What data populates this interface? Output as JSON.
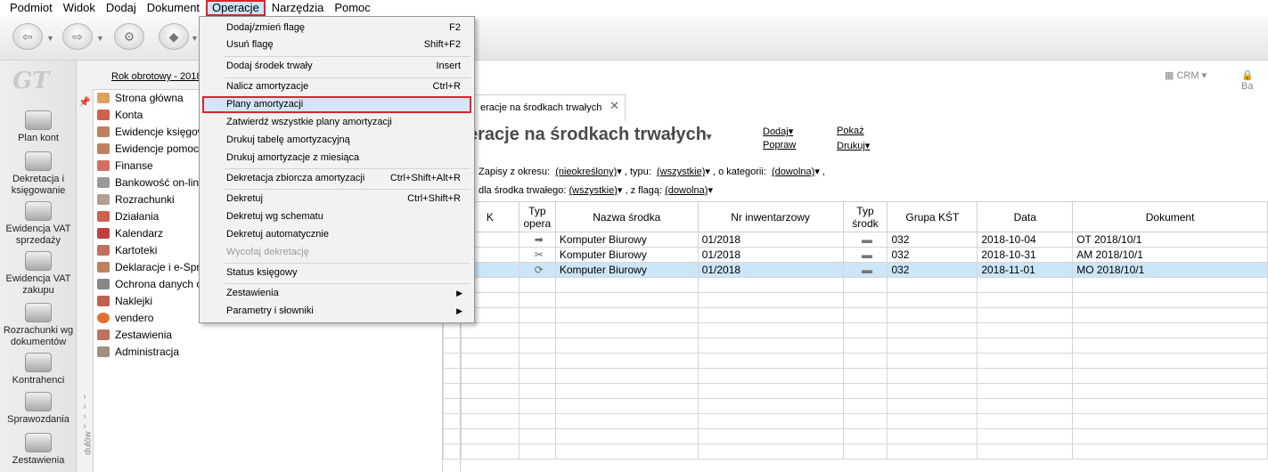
{
  "menubar": [
    "Podmiot",
    "Widok",
    "Dodaj",
    "Dokument",
    "Operacje",
    "Narzędzia",
    "Pomoc"
  ],
  "active_menu": "Operacje",
  "modules": [
    {
      "label": "Plan kont"
    },
    {
      "label": "Dekretacja i księgowanie"
    },
    {
      "label": "Ewidencja VAT sprzedaży"
    },
    {
      "label": "Ewidencja VAT zakupu"
    },
    {
      "label": "Rozrachunki wg dokumentów"
    },
    {
      "label": "Kontrahenci"
    },
    {
      "label": "Sprawozdania"
    },
    {
      "label": "Zestawienia"
    }
  ],
  "logo_text": "GT",
  "fiscal_year": "Rok obrotowy - 2018",
  "tree": [
    "Strona główna",
    "Konta",
    "Ewidencje księgow",
    "Ewidencje pomocr",
    "Finanse",
    "Bankowość on-line",
    "Rozrachunki",
    "Działania",
    "Kalendarz",
    "Kartoteki",
    "Deklaracje i e-Spra",
    "Ochrona danych o",
    "Naklejki",
    "vendero",
    "Zestawienia",
    "Administracja"
  ],
  "side_grip_text": "dułów",
  "header_right": {
    "crm": "CRM",
    "ba": "Ba"
  },
  "tab": {
    "label": "eracje na środkach trwałych"
  },
  "page": {
    "title": "eracje na środkach trwałych",
    "actions": {
      "dodaj": "Dodaj",
      "popraw": "Popraw",
      "pokaz": "Pokaż",
      "drukuj": "Drukuj"
    },
    "filters": {
      "label1": "Zapisy z okresu:",
      "okres": "(nieokreślony)",
      "label2": ", typu:",
      "typ": "(wszystkie)",
      "label3": ", o kategorii:",
      "kategoria": "(dowolna)",
      "label4": "dla środka trwałego:",
      "srodek": "(wszystkie)",
      "label5": ", z flagą:",
      "flaga": "(dowolna)"
    }
  },
  "grid": {
    "columns": [
      "K",
      "Typ opera",
      "Nazwa środka",
      "Nr inwentarzowy",
      "Typ środk",
      "Grupa KŚT",
      "Data",
      "Dokument"
    ],
    "rows": [
      {
        "icon": "arrow-right-icon",
        "glyph": "➡",
        "name": "Komputer Biurowy",
        "inv": "01/2018",
        "grupa": "032",
        "data": "2018-10-04",
        "dok": "OT 2018/10/1"
      },
      {
        "icon": "scissors-icon",
        "glyph": "✂",
        "name": "Komputer Biurowy",
        "inv": "01/2018",
        "grupa": "032",
        "data": "2018-10-31",
        "dok": "AM 2018/10/1"
      },
      {
        "icon": "refresh-icon",
        "glyph": "⟳",
        "name": "Komputer Biurowy",
        "inv": "01/2018",
        "grupa": "032",
        "data": "2018-11-01",
        "dok": "MO 2018/10/1"
      }
    ],
    "selected_row": 2
  },
  "menu": {
    "items": [
      {
        "label": "Dodaj/zmień flagę",
        "shortcut": "F2"
      },
      {
        "label": "Usuń flagę",
        "shortcut": "Shift+F2"
      },
      {
        "label": "Dodaj środek trwały",
        "shortcut": "Insert"
      },
      {
        "label": "Nalicz amortyzacje",
        "shortcut": "Ctrl+R"
      },
      {
        "label": "Plany amortyzacji",
        "shortcut": ""
      },
      {
        "label": "Zatwierdź wszystkie plany amortyzacji",
        "shortcut": ""
      },
      {
        "label": "Drukuj tabelę amortyzacyjną",
        "shortcut": ""
      },
      {
        "label": "Drukuj amortyzacje z miesiąca",
        "shortcut": ""
      },
      {
        "label": "Dekretacja zbiorcza amortyzacji",
        "shortcut": "Ctrl+Shift+Alt+R"
      },
      {
        "label": "Dekretuj",
        "shortcut": "Ctrl+Shift+R"
      },
      {
        "label": "Dekretuj wg schematu",
        "shortcut": ""
      },
      {
        "label": "Dekretuj automatycznie",
        "shortcut": ""
      },
      {
        "label": "Wycofaj dekretację",
        "shortcut": ""
      },
      {
        "label": "Status księgowy",
        "shortcut": ""
      },
      {
        "label": "Zestawienia",
        "shortcut": ""
      },
      {
        "label": "Parametry i słowniki",
        "shortcut": ""
      }
    ]
  },
  "colors": {
    "highlight_border": "#d9262f",
    "selection": "#cde6f7",
    "menu_bg": "#f2f2f2"
  }
}
